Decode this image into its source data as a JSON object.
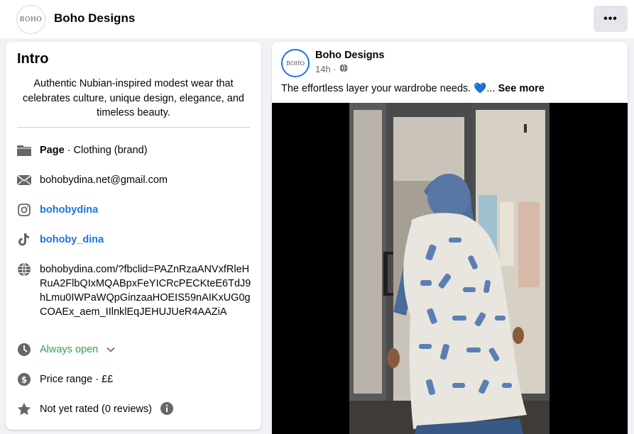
{
  "header": {
    "page_name": "Boho Designs",
    "avatar_text": "BOHO",
    "more_label": "•••"
  },
  "intro": {
    "title": "Intro",
    "bio": "Authentic Nubian-inspired modest wear that celebrates culture, unique design, elegance, and timeless beauty.",
    "category_prefix": "Page",
    "category": " · Clothing (brand)",
    "email": "bohobydina.net@gmail.com",
    "instagram": "bohobydina",
    "tiktok": "bohoby_dina",
    "website": "bohobydina.com/?fbclid=PAZnRzaANVxfRleHRuA2FlbQIxMQABpxFeYICRcPECKteE6TdJ9hLmu0IWPaWQpGinzaaHOEIS59nAIKxUG0gCOAEx_aem_IIlnklEqJEHUJUeR4AAZiA",
    "hours": "Always open",
    "price_range": "Price range · ££",
    "rating": "Not yet rated (0 reviews)"
  },
  "post": {
    "author": "Boho Designs",
    "avatar_text": "BOHO",
    "time": "14h ·",
    "text": "The effortless layer your wardrobe needs. 💙...",
    "see_more": "See more"
  }
}
